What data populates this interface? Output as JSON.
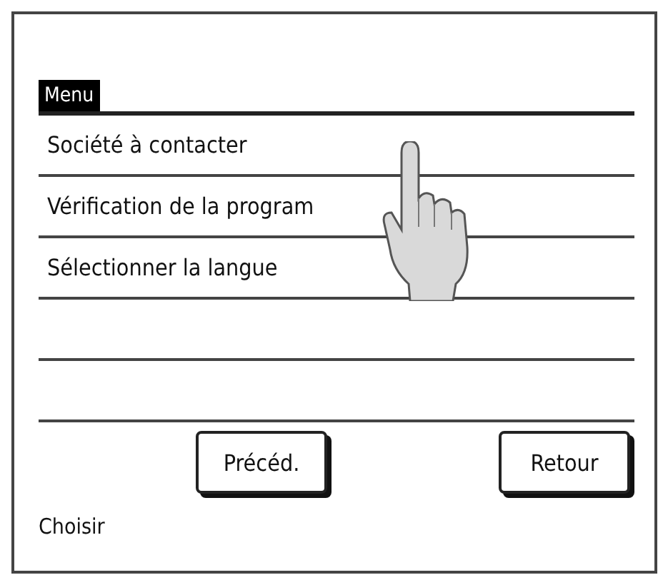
{
  "menu": {
    "title": "Menu",
    "items": [
      {
        "label": "Société à contacter"
      },
      {
        "label": "Vérification de la program"
      },
      {
        "label": "Sélectionner la langue"
      }
    ]
  },
  "buttons": [
    {
      "label": "Précéd."
    },
    {
      "label": "Retour"
    }
  ],
  "status": "Choisir"
}
